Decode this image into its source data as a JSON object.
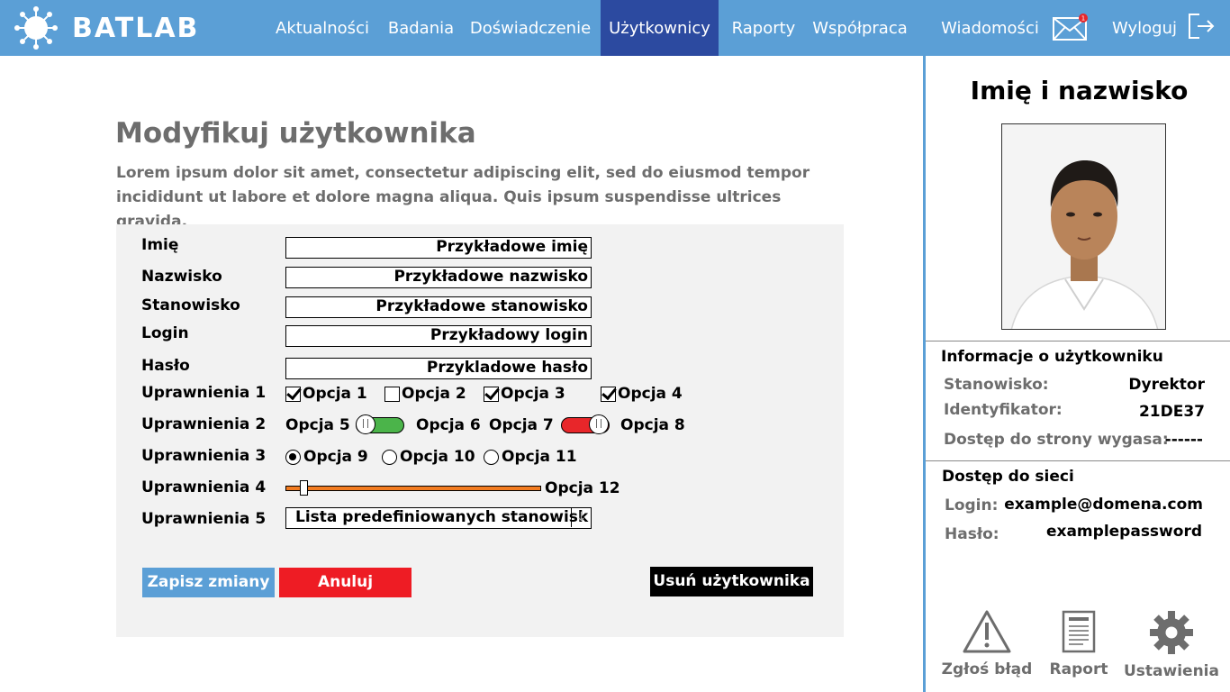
{
  "app": {
    "logo_text": "BATLAB"
  },
  "nav": {
    "items": [
      "Aktualności",
      "Badania",
      "Doświadczenie",
      "Użytkownicy",
      "Raporty",
      "Współpraca"
    ],
    "messages_label": "Wiadomości",
    "messages_badge": "1",
    "logout_label": "Wyloguj"
  },
  "main": {
    "title": "Modyfikuj użytkownika",
    "description": "Lorem ipsum dolor sit amet, consectetur adipiscing elit, sed do eiusmod tempor incididunt ut labore et dolore magna aliqua. Quis ipsum suspendisse ultrices gravida."
  },
  "form": {
    "fields": [
      {
        "label": "Imię",
        "value": "Przykładowe imię"
      },
      {
        "label": "Nazwisko",
        "value": "Przykładowe nazwisko"
      },
      {
        "label": "Stanowisko",
        "value": "Przykładowe stanowisko"
      },
      {
        "label": "Login",
        "value": "Przykładowy login"
      },
      {
        "label": "Hasło",
        "value": "Przykladowe hasło"
      }
    ],
    "perm1": {
      "label": "Uprawnienia 1",
      "options": [
        "Opcja 1",
        "Opcja 2",
        "Opcja 3",
        "Opcja 4"
      ],
      "checked": [
        true,
        false,
        true,
        true
      ]
    },
    "perm2": {
      "label": "Uprawnienia 2",
      "options": [
        "Opcja 5",
        "Opcja 6",
        "Opcja 7",
        "Opcja 8"
      ]
    },
    "perm3": {
      "label": "Uprawnienia 3",
      "options": [
        "Opcja 9",
        "Opcja 10",
        "Opcja 11"
      ],
      "selected": "Opcja 9"
    },
    "perm4": {
      "label": "Uprawnienia 4",
      "option": "Opcja 12",
      "slider_fraction": 0.06
    },
    "perm5": {
      "label": "Uprawnienia 5",
      "select_value": "Lista predefiniowanych stanowisk"
    },
    "buttons": {
      "save": "Zapisz zmiany",
      "cancel": "Anuluj",
      "delete": "Usuń użytkownika"
    },
    "colors": {
      "save": "#5b9fd6",
      "cancel": "#ee1c24",
      "delete": "#000000",
      "slider": "#f27b20",
      "toggle_green": "#4bb44a",
      "toggle_red": "#e8262a"
    }
  },
  "sidebar": {
    "name": "Imię i nazwisko",
    "info_heading": "Informacje o użytkowniku",
    "info": [
      {
        "key": "Stanowisko:",
        "value": "Dyrektor"
      },
      {
        "key": "Identyfikator:",
        "value": "21DE37"
      },
      {
        "key": "Dostęp do strony wygasa:",
        "value": "------"
      }
    ],
    "network_heading": "Dostęp do sieci",
    "network": [
      {
        "key": "Login:",
        "value": "example@domena.com"
      },
      {
        "key": "Hasło:",
        "value": "examplepassword"
      }
    ],
    "tools": [
      "Zgłoś błąd",
      "Raport",
      "Ustawienia"
    ]
  },
  "theme": {
    "primary": "#5b9fd6",
    "nav_active": "#2c4aa0"
  }
}
